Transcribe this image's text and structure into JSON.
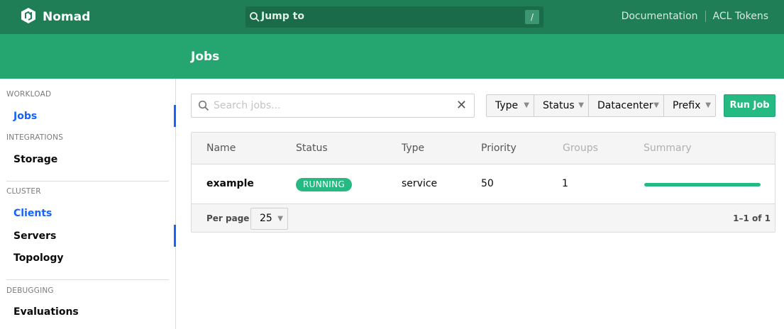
{
  "topbar": {
    "brand": "Nomad",
    "jump_to": "Jump to",
    "jump_shortcut": "/",
    "links": [
      "Documentation",
      "ACL Tokens"
    ]
  },
  "subheader": {
    "title": "Jobs"
  },
  "sidebar": {
    "sections": [
      {
        "label": "WORKLOAD",
        "items": [
          {
            "label": "Jobs",
            "active": true
          }
        ]
      },
      {
        "label": "INTEGRATIONS",
        "items": [
          {
            "label": "Storage",
            "active": false
          }
        ]
      },
      {
        "label": "CLUSTER",
        "items": [
          {
            "label": "Clients",
            "active": true
          },
          {
            "label": "Servers",
            "active": false
          },
          {
            "label": "Topology",
            "active": false
          }
        ]
      },
      {
        "label": "DEBUGGING",
        "items": [
          {
            "label": "Evaluations",
            "active": false
          }
        ]
      }
    ]
  },
  "toolbar": {
    "search_placeholder": "Search jobs...",
    "filters": [
      "Type",
      "Status",
      "Datacenter",
      "Prefix"
    ],
    "run_job": "Run Job"
  },
  "table": {
    "columns": [
      "Name",
      "Status",
      "Type",
      "Priority",
      "Groups",
      "Summary"
    ],
    "rows": [
      {
        "name": "example",
        "status": "RUNNING",
        "type": "service",
        "priority": "50",
        "groups": "1",
        "summary_fraction": 1.0
      }
    ],
    "footer": {
      "per_page_label": "Per page",
      "per_page_value": "25",
      "range": "1–1 of 1"
    }
  },
  "colors": {
    "topbar": "#1f7e56",
    "subheader": "#25a56f",
    "accent": "#25ba81",
    "active_nav": "#1563ff"
  },
  "icons": [
    "nomad-logo-icon",
    "search-icon",
    "clear-icon",
    "chevron-down-icon"
  ]
}
